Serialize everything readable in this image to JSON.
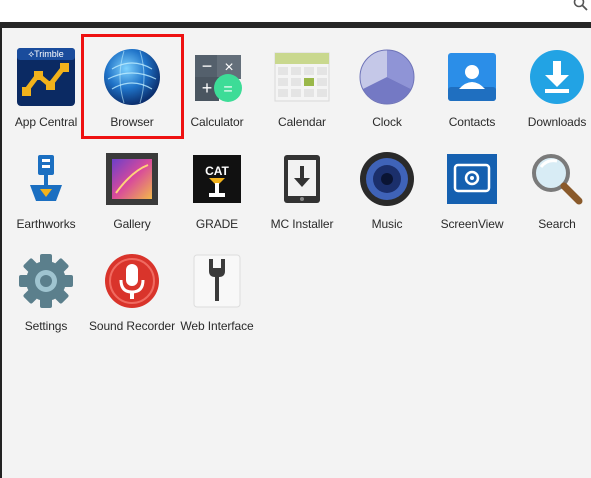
{
  "colors": {
    "background": "#f3f3f3",
    "label_text": "#2a2a2a",
    "highlight": "#e11111"
  },
  "top_search_icon": "search-icon",
  "apps": [
    {
      "label": "App Central",
      "icon": "trimble-app-central-icon",
      "highlighted": false
    },
    {
      "label": "Browser",
      "icon": "globe-icon",
      "highlighted": true
    },
    {
      "label": "Calculator",
      "icon": "calculator-icon",
      "highlighted": false
    },
    {
      "label": "Calendar",
      "icon": "calendar-icon",
      "highlighted": false
    },
    {
      "label": "Clock",
      "icon": "clock-icon",
      "highlighted": false
    },
    {
      "label": "Contacts",
      "icon": "contacts-icon",
      "highlighted": false
    },
    {
      "label": "Downloads",
      "icon": "download-icon",
      "highlighted": false
    },
    {
      "label": "Earthworks",
      "icon": "earthworks-icon",
      "highlighted": false
    },
    {
      "label": "Gallery",
      "icon": "gallery-icon",
      "highlighted": false
    },
    {
      "label": "GRADE",
      "icon": "cat-grade-icon",
      "highlighted": false
    },
    {
      "label": "MC Installer",
      "icon": "installer-icon",
      "highlighted": false
    },
    {
      "label": "Music",
      "icon": "speaker-icon",
      "highlighted": false
    },
    {
      "label": "ScreenView",
      "icon": "screenview-icon",
      "highlighted": false
    },
    {
      "label": "Search",
      "icon": "magnifier-icon",
      "highlighted": false
    },
    {
      "label": "Settings",
      "icon": "gear-icon",
      "highlighted": false
    },
    {
      "label": "Sound Recorder",
      "icon": "microphone-icon",
      "highlighted": false
    },
    {
      "label": "Web Interface",
      "icon": "wrench-icon",
      "highlighted": false
    }
  ]
}
